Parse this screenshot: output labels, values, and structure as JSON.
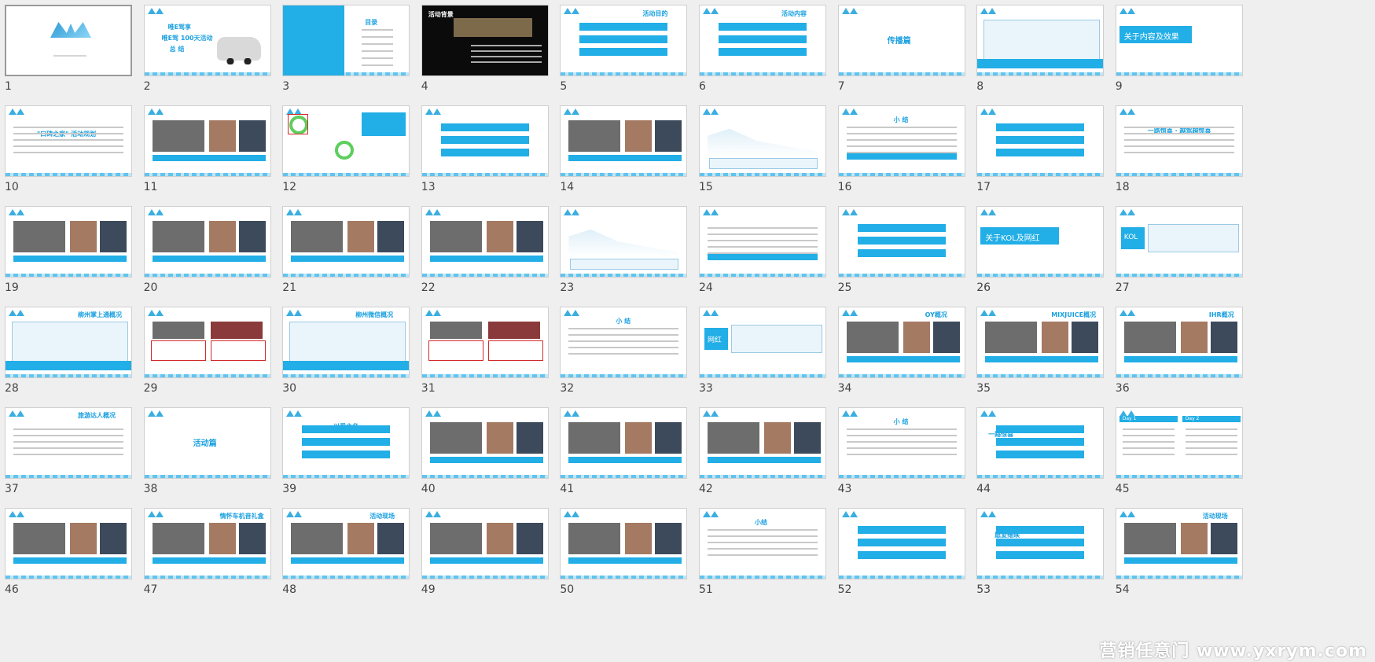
{
  "app": {
    "view": "slide-sorter",
    "accent_color": "#22aee6",
    "watermark": "营销任意门 www.yxrym.com"
  },
  "slides": [
    {
      "num": "1",
      "kind": "cover",
      "selected": true
    },
    {
      "num": "2",
      "kind": "car"
    },
    {
      "num": "3",
      "kind": "toc"
    },
    {
      "num": "4",
      "kind": "dark"
    },
    {
      "num": "5",
      "kind": "bars"
    },
    {
      "num": "6",
      "kind": "bars"
    },
    {
      "num": "7",
      "kind": "section",
      "title": "传播篇"
    },
    {
      "num": "8",
      "kind": "table"
    },
    {
      "num": "9",
      "kind": "section-block",
      "title": "关于内容及效果"
    },
    {
      "num": "10",
      "kind": "text"
    },
    {
      "num": "11",
      "kind": "photos"
    },
    {
      "num": "12",
      "kind": "ring"
    },
    {
      "num": "13",
      "kind": "bars"
    },
    {
      "num": "14",
      "kind": "photos"
    },
    {
      "num": "15",
      "kind": "chart"
    },
    {
      "num": "16",
      "kind": "text"
    },
    {
      "num": "17",
      "kind": "bars"
    },
    {
      "num": "18",
      "kind": "text"
    },
    {
      "num": "19",
      "kind": "photos"
    },
    {
      "num": "20",
      "kind": "photos"
    },
    {
      "num": "21",
      "kind": "photos"
    },
    {
      "num": "22",
      "kind": "photos"
    },
    {
      "num": "23",
      "kind": "chart"
    },
    {
      "num": "24",
      "kind": "text"
    },
    {
      "num": "25",
      "kind": "bars"
    },
    {
      "num": "26",
      "kind": "section-block",
      "title": "关于KOL及网红"
    },
    {
      "num": "27",
      "kind": "table",
      "label": "KOL"
    },
    {
      "num": "28",
      "kind": "table"
    },
    {
      "num": "29",
      "kind": "redbox"
    },
    {
      "num": "30",
      "kind": "table"
    },
    {
      "num": "31",
      "kind": "redbox"
    },
    {
      "num": "32",
      "kind": "text"
    },
    {
      "num": "33",
      "kind": "table",
      "label": "网红"
    },
    {
      "num": "34",
      "kind": "photos"
    },
    {
      "num": "35",
      "kind": "photos"
    },
    {
      "num": "36",
      "kind": "photos"
    },
    {
      "num": "37",
      "kind": "text"
    },
    {
      "num": "38",
      "kind": "section",
      "title": "活动篇"
    },
    {
      "num": "39",
      "kind": "bars"
    },
    {
      "num": "40",
      "kind": "photos"
    },
    {
      "num": "41",
      "kind": "photos"
    },
    {
      "num": "42",
      "kind": "photos"
    },
    {
      "num": "43",
      "kind": "text"
    },
    {
      "num": "44",
      "kind": "bars"
    },
    {
      "num": "45",
      "kind": "day"
    },
    {
      "num": "46",
      "kind": "photos"
    },
    {
      "num": "47",
      "kind": "photos"
    },
    {
      "num": "48",
      "kind": "photos"
    },
    {
      "num": "49",
      "kind": "photos"
    },
    {
      "num": "50",
      "kind": "photos"
    },
    {
      "num": "51",
      "kind": "text"
    },
    {
      "num": "52",
      "kind": "bars"
    },
    {
      "num": "53",
      "kind": "bars"
    },
    {
      "num": "54",
      "kind": "photos"
    }
  ],
  "slide_texts": {
    "s2_lines": [
      "唯E驾享",
      "唯E驾 100天活动",
      "总 结"
    ],
    "s3_title": "目录",
    "s4_title": "活动背景",
    "s6_title": "活动内容",
    "s5_title": "活动目的",
    "s10_title": "\"口碑之家\" 活动规划",
    "s18_title": "一路惊喜 · 越驾越惊喜",
    "s16_title": "小 结",
    "s32_title": "小 结",
    "s43_title": "小 结",
    "s51_title": "小结",
    "s39_title": "以爱之名",
    "s44_title": "一路惊喜",
    "s53_title": "愿爱维续",
    "s45_day1": "Day 1",
    "s45_day2": "Day 2",
    "s28_title": "柳州掌上通概况",
    "s30_title": "柳州微信概况",
    "s34_title": "OY概况",
    "s35_title": "MIXJUICE概况",
    "s36_title": "IHR概况",
    "s37_title": "旅游达人概况",
    "s47_title": "情怀车机音礼盒",
    "s48_title": "活动现场",
    "s54_title": "活动现场"
  }
}
